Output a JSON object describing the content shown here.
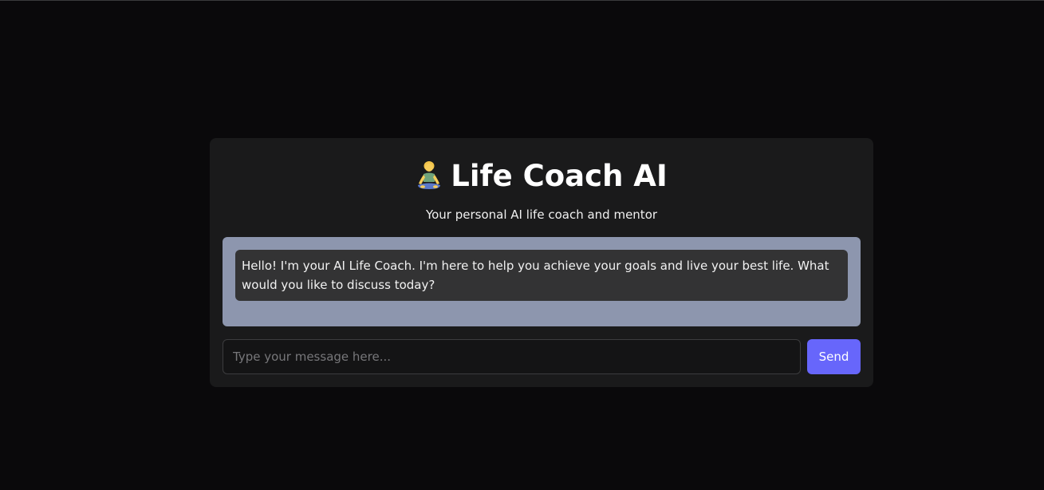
{
  "header": {
    "icon": "person-in-lotus-position-icon",
    "title": "Life Coach AI",
    "subtitle": "Your personal AI life coach and mentor"
  },
  "chat": {
    "messages": [
      {
        "sender": "assistant",
        "text": "Hello! I'm your AI Life Coach. I'm here to help you achieve your goals and live your best life. What would you like to discuss today?"
      }
    ]
  },
  "composer": {
    "placeholder": "Type your message here...",
    "value": "",
    "send_label": "Send"
  },
  "colors": {
    "background": "#0a090b",
    "card": "#1a1a1b",
    "chat_area": "#8d96ae",
    "message_bubble": "#333334",
    "accent": "#6766fb"
  }
}
